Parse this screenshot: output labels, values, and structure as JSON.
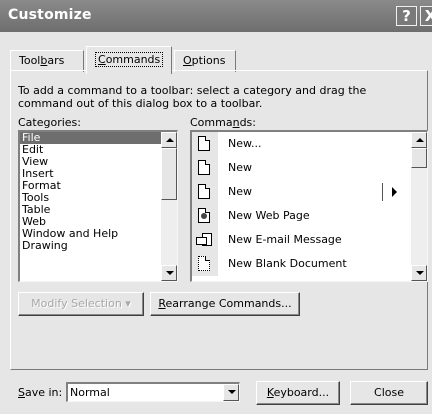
{
  "window": {
    "title": "Customize",
    "help_label": "?",
    "close_label": "X"
  },
  "tabs": [
    {
      "pre": "Tool",
      "u": "b",
      "post": "ars",
      "active": false
    },
    {
      "pre": "",
      "u": "C",
      "post": "ommands",
      "active": true
    },
    {
      "pre": "",
      "u": "O",
      "post": "ptions",
      "active": false
    }
  ],
  "instructions": "To add a command to a toolbar: select a category and drag the command out of this dialog box to a toolbar.",
  "categories_label": "Categories:",
  "commands_label": {
    "pre": "Comma",
    "u": "n",
    "post": "ds:"
  },
  "categories": [
    "File",
    "Edit",
    "View",
    "Insert",
    "Format",
    "Tools",
    "Table",
    "Web",
    "Window and Help",
    "Drawing"
  ],
  "selected_category": "File",
  "commands": [
    {
      "label": "New...",
      "icon": "document-icon"
    },
    {
      "label": "New",
      "icon": "document-icon"
    },
    {
      "label": "New",
      "icon": "document-icon",
      "submenu": true
    },
    {
      "label": "New Web Page",
      "icon": "web-page-icon"
    },
    {
      "label": "New E-mail Message",
      "icon": "email-message-icon"
    },
    {
      "label": "New Blank Document",
      "icon": "blank-document-icon"
    }
  ],
  "buttons": {
    "modify_selection": "Modify Selection",
    "modify_arrow": "▾",
    "rearrange": {
      "pre": "",
      "u": "R",
      "post": "earrange Commands..."
    },
    "keyboard": {
      "pre": "",
      "u": "K",
      "post": "eyboard..."
    },
    "close": "Close"
  },
  "save_in": {
    "label_pre": "",
    "label_u": "S",
    "label_post": "ave in:",
    "value": "Normal"
  }
}
